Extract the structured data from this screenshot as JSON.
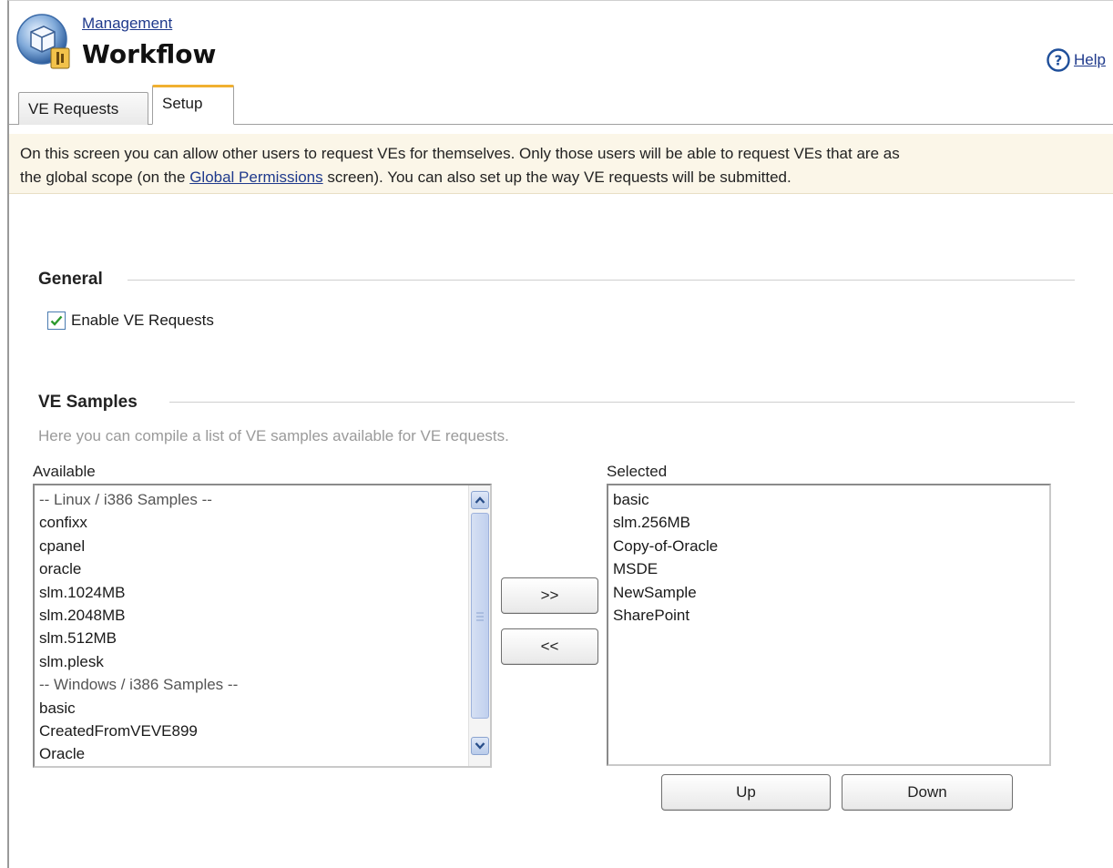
{
  "header": {
    "breadcrumb": "Management",
    "title": "Workflow",
    "help_label": "Help",
    "app_icon": "workflow-app-icon",
    "help_icon": "question-circle-icon"
  },
  "tabs": [
    {
      "label": "VE Requests",
      "active": false
    },
    {
      "label": "Setup",
      "active": true
    }
  ],
  "info": {
    "text_before_link": "On this screen you can allow other users to request VEs for themselves. Only those users will be able to request VEs that are as",
    "line2_before_link": "the global scope (on the ",
    "link_text": "Global Permissions",
    "line2_after_link": " screen). You can also set up the way VE requests will be submitted."
  },
  "general": {
    "title": "General",
    "enable_label": "Enable VE Requests",
    "enable_checked": true
  },
  "samples": {
    "title": "VE Samples",
    "hint": "Here you can compile a list of VE samples available for VE requests.",
    "available_label": "Available",
    "selected_label": "Selected",
    "available": [
      {
        "label": "-- Linux / i386 Samples --",
        "group": true
      },
      {
        "label": "confixx",
        "group": false
      },
      {
        "label": "cpanel",
        "group": false
      },
      {
        "label": "oracle",
        "group": false
      },
      {
        "label": "slm.1024MB",
        "group": false
      },
      {
        "label": "slm.2048MB",
        "group": false
      },
      {
        "label": "slm.512MB",
        "group": false
      },
      {
        "label": "slm.plesk",
        "group": false
      },
      {
        "label": "-- Windows / i386 Samples --",
        "group": true
      },
      {
        "label": "basic",
        "group": false
      },
      {
        "label": "CreatedFromVEVE899",
        "group": false
      },
      {
        "label": "Oracle",
        "group": false
      }
    ],
    "selected": [
      "basic",
      "slm.256MB",
      "Copy-of-Oracle",
      "MSDE",
      "NewSample",
      "SharePoint"
    ],
    "add_label": ">>",
    "remove_label": "<<",
    "up_label": "Up",
    "down_label": "Down"
  },
  "colors": {
    "link": "#1f3a8c",
    "tab_accent": "#f0b030",
    "info_background": "#fbf6e8",
    "hint_text": "#9a9a9a"
  }
}
